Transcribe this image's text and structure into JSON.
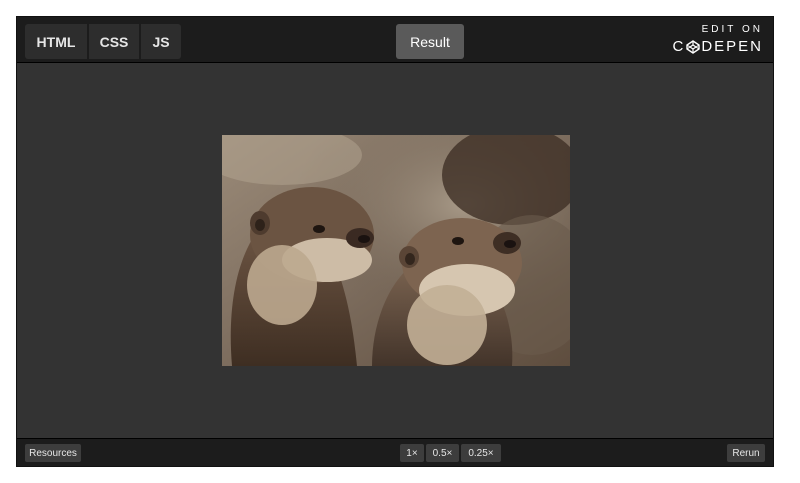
{
  "tabs": {
    "html_label": "HTML",
    "css_label": "CSS",
    "js_label": "JS",
    "result_label": "Result"
  },
  "brand": {
    "edit_on": "EDIT ON",
    "name_prefix": "C",
    "name_suffix": "DEPEN",
    "logo_icon": "codepen-logo-icon"
  },
  "preview": {
    "image_subject": "otters-photo"
  },
  "footer": {
    "resources_label": "Resources",
    "zoom_options": [
      "1×",
      "0.5×",
      "0.25×"
    ],
    "rerun_label": "Rerun"
  },
  "colors": {
    "panel_bg": "#333333",
    "bar_bg": "#1c1c1c",
    "active_tab": "#5a5a5a"
  }
}
